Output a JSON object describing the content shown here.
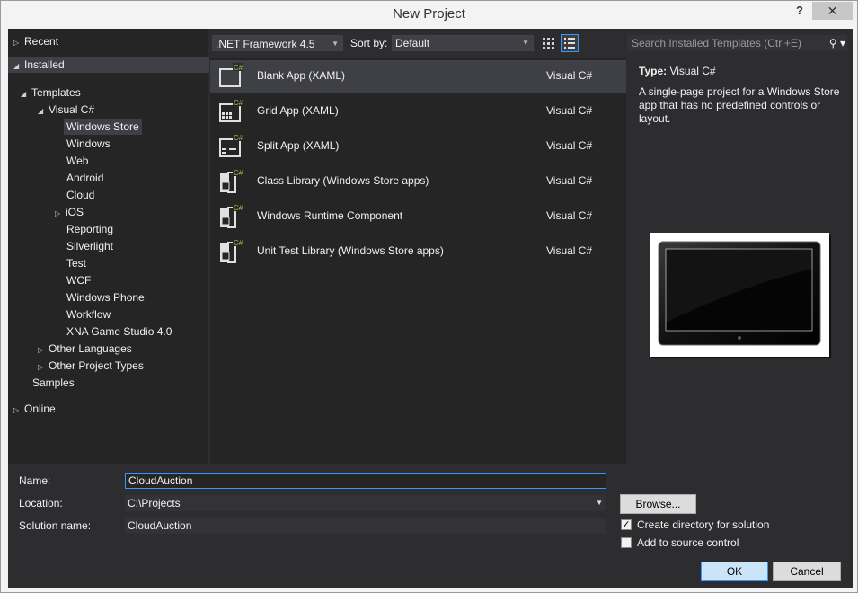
{
  "window": {
    "title": "New Project",
    "help_label": "?",
    "close_label": "✕"
  },
  "tree": {
    "recent": "Recent",
    "installed": "Installed",
    "templates": "Templates",
    "visual_csharp": "Visual C#",
    "children": [
      "Windows Store",
      "Windows",
      "Web",
      "Android",
      "Cloud",
      "iOS",
      "Reporting",
      "Silverlight",
      "Test",
      "WCF",
      "Windows Phone",
      "Workflow",
      "XNA Game Studio 4.0"
    ],
    "other_languages": "Other Languages",
    "other_project_types": "Other Project Types",
    "samples": "Samples",
    "online": "Online"
  },
  "toolbar": {
    "framework": ".NET Framework 4.5",
    "sort_label": "Sort by:",
    "sort_value": "Default",
    "search_placeholder": "Search Installed Templates (Ctrl+E)"
  },
  "templates": [
    {
      "name": "Blank App (XAML)",
      "lang": "Visual C#",
      "icon": "blank-app-icon"
    },
    {
      "name": "Grid App (XAML)",
      "lang": "Visual C#",
      "icon": "grid-app-icon"
    },
    {
      "name": "Split App (XAML)",
      "lang": "Visual C#",
      "icon": "split-app-icon"
    },
    {
      "name": "Class Library (Windows Store apps)",
      "lang": "Visual C#",
      "icon": "class-library-icon"
    },
    {
      "name": "Windows Runtime Component",
      "lang": "Visual C#",
      "icon": "runtime-component-icon"
    },
    {
      "name": "Unit Test Library (Windows Store apps)",
      "lang": "Visual C#",
      "icon": "unit-test-icon"
    }
  ],
  "details": {
    "type_label": "Type:",
    "type_value": "Visual C#",
    "description": "A single-page project for a Windows Store app that has no predefined controls or layout."
  },
  "form": {
    "name_label": "Name:",
    "name_value": "CloudAuction",
    "location_label": "Location:",
    "location_value": "C:\\Projects",
    "solution_label": "Solution name:",
    "solution_value": "CloudAuction",
    "browse_label": "Browse...",
    "create_dir_label": "Create directory for solution",
    "create_dir_checked": true,
    "source_control_label": "Add to source control",
    "source_control_checked": false,
    "ok_label": "OK",
    "cancel_label": "Cancel"
  },
  "colors": {
    "accent": "#3399ff",
    "background": "#2d2d30",
    "panel": "#252526",
    "selection": "#3f3f46"
  }
}
